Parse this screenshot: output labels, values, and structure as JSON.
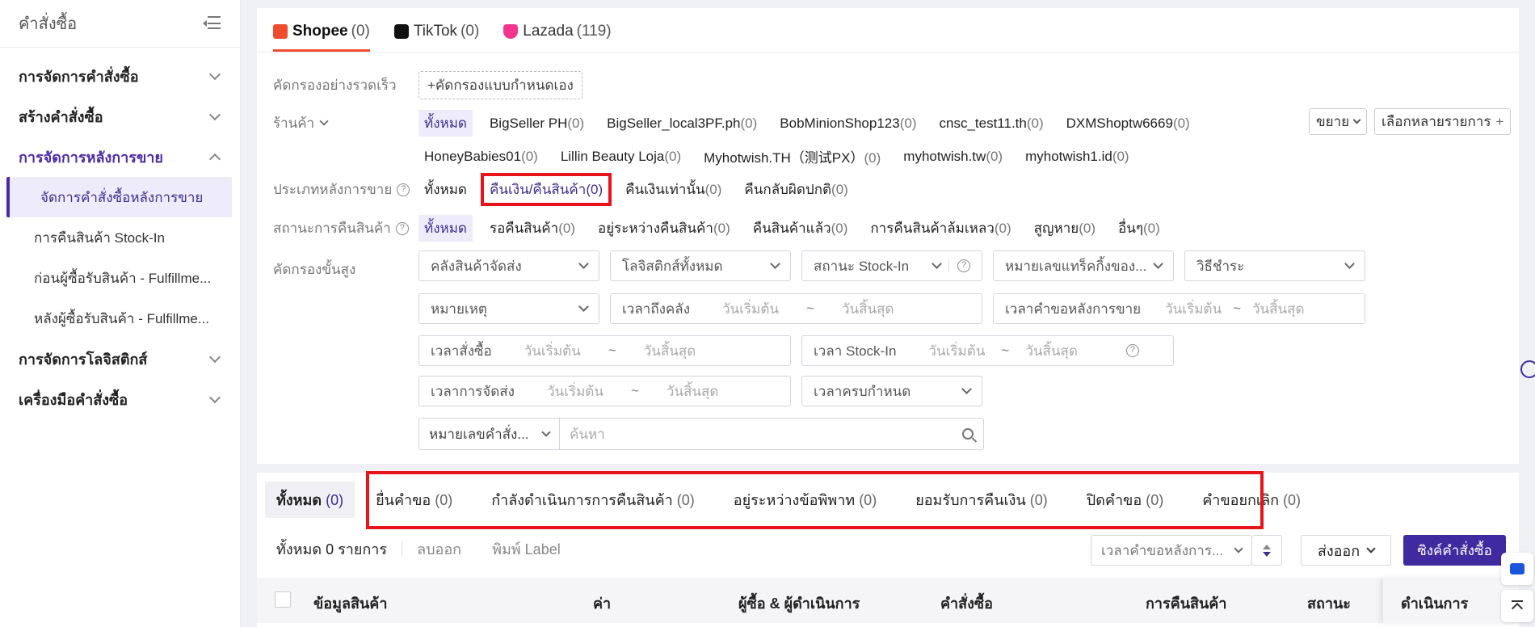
{
  "sidebar": {
    "title": "คำสั่งซื้อ",
    "groups": [
      {
        "label": "การจัดการคำสั่งซื้อ"
      },
      {
        "label": "สร้างคำสั่งซื้อ"
      },
      {
        "label": "การจัดการหลังการขาย"
      },
      {
        "label": "การจัดการโลจิสติกส์"
      },
      {
        "label": "เครื่องมือคำสั่งซื้อ"
      }
    ],
    "items": [
      {
        "label": "จัดการคำสั่งซื้อหลังการขาย"
      },
      {
        "label": "การคืนสินค้า Stock-In"
      },
      {
        "label": "ก่อนผู้ซื้อรับสินค้า - Fulfillme..."
      },
      {
        "label": "หลังผู้ซื้อรับสินค้า - Fulfillme..."
      }
    ]
  },
  "platform_tabs": [
    {
      "name": "Shopee",
      "count": "(0)"
    },
    {
      "name": "TikTok",
      "count": "(0)"
    },
    {
      "name": "Lazada",
      "count": "(119)"
    }
  ],
  "filters": {
    "quick_label": "คัดกรองอย่างรวดเร็ว",
    "custom_button": "+คัดกรองแบบกำหนดเอง",
    "shop_label": "ร้านค้า",
    "shops_row1": [
      {
        "name": "ทั้งหมด",
        "n": ""
      },
      {
        "name": "BigSeller PH",
        "n": "(0)"
      },
      {
        "name": "BigSeller_local3PF.ph",
        "n": "(0)"
      },
      {
        "name": "BobMinionShop123",
        "n": "(0)"
      },
      {
        "name": "cnsc_test11.th",
        "n": "(0)"
      },
      {
        "name": "DXMShoptw6669",
        "n": "(0)"
      }
    ],
    "shops_row2": [
      {
        "name": "HoneyBabies01",
        "n": "(0)"
      },
      {
        "name": "Lillin Beauty Loja",
        "n": "(0)"
      },
      {
        "name": "Myhotwish.TH（测试PX）",
        "n": "(0)"
      },
      {
        "name": "myhotwish.tw",
        "n": "(0)"
      },
      {
        "name": "myhotwish1.id",
        "n": "(0)"
      }
    ],
    "expand_label": "ขยาย",
    "multi_select_label": "เลือกหลายรายการ",
    "aftersale_type_label": "ประเภทหลังการขาย",
    "aftersale_types": [
      {
        "name": "ทั้งหมด",
        "n": ""
      },
      {
        "name": "คืนเงิน/คืนสินค้า",
        "n": "(0)"
      },
      {
        "name": "คืนเงินเท่านั้น",
        "n": "(0)"
      },
      {
        "name": "คืนกลับผิดปกติ",
        "n": "(0)"
      }
    ],
    "return_status_label": "สถานะการคืนสินค้า",
    "return_statuses": [
      {
        "name": "ทั้งหมด",
        "n": ""
      },
      {
        "name": "รอคืนสินค้า",
        "n": "(0)"
      },
      {
        "name": "อยู่ระหว่างคืนสินค้า",
        "n": "(0)"
      },
      {
        "name": "คืนสินค้าแล้ว",
        "n": "(0)"
      },
      {
        "name": "การคืนสินค้าล้มเหลว",
        "n": "(0)"
      },
      {
        "name": "สูญหาย",
        "n": "(0)"
      },
      {
        "name": "อื่นๆ",
        "n": "(0)"
      }
    ],
    "advanced_label": "คัดกรองขั้นสูง",
    "warehouse": "คลังสินค้าจัดส่ง",
    "logistics": "โลจิสติกส์ทั้งหมด",
    "stockin_status": "สถานะ Stock-In",
    "tracking": "หมายเลขแทร็คกิ้งของ...",
    "payment": "วิธีชำระ",
    "note": "หมายเหตุ",
    "warehouse_time": "เวลาถึงคลัง",
    "aftersale_request_time": "เวลาคำขอหลังการขาย",
    "order_time": "เวลาสั่งซื้อ",
    "stockin_time": "เวลา Stock-In",
    "ship_time": "เวลาการจัดส่ง",
    "due_time": "เวลาครบกำหนด",
    "start_ph": "วันเริ่มต้น",
    "end_ph": "วันสิ้นสุด",
    "tilde": "~",
    "search_field": "หมายเลขคำสั่ง...",
    "search_ph": "ค้นหา"
  },
  "status_tabs": [
    {
      "name": "ทั้งหมด",
      "n": "(0)"
    },
    {
      "name": "ยื่นคำขอ",
      "n": "(0)"
    },
    {
      "name": "กำลังดำเนินการการคืนสินค้า",
      "n": "(0)"
    },
    {
      "name": "อยู่ระหว่างข้อพิพาท",
      "n": "(0)"
    },
    {
      "name": "ยอมรับการคืนเงิน",
      "n": "(0)"
    },
    {
      "name": "ปิดคำขอ",
      "n": "(0)"
    },
    {
      "name": "คำขอยกเลิก",
      "n": "(0)"
    }
  ],
  "toolbar": {
    "total": "ทั้งหมด 0 รายการ",
    "delete": "ลบออก",
    "print": "พิมพ์ Label",
    "sort": "เวลาคำขอหลังการ...",
    "export": "ส่งออก",
    "sync": "ซิงค์คำสั่งซื้อ"
  },
  "table_headers": {
    "product": "ข้อมูลสินค้า",
    "price": "ค่า",
    "buyer": "ผู้ซื้อ & ผู้ดำเนินการ",
    "order": "คำสั่งซื้อ",
    "return": "การคืนสินค้า",
    "status": "สถานะ",
    "action": "ดำเนินการ"
  },
  "colors": {
    "accent": "#3f2aa0",
    "shopee": "#ee4d2d",
    "highlight": "#e8141b"
  }
}
